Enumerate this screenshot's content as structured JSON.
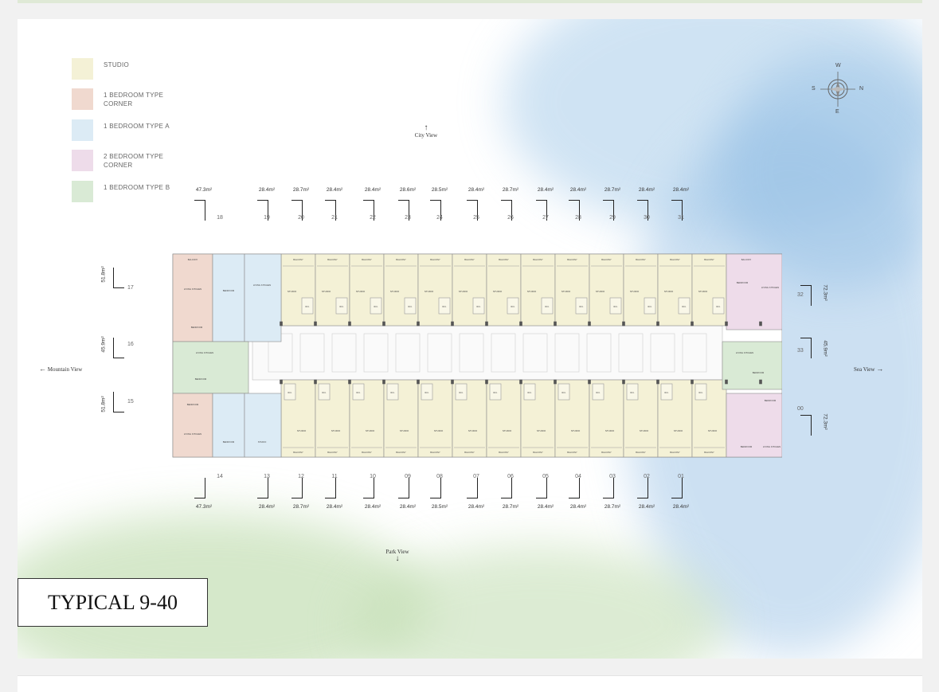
{
  "page_title": "TYPICAL 9-40",
  "legend": [
    {
      "label": "STUDIO",
      "color": "#f4f1d6"
    },
    {
      "label": "1 BEDROOM TYPE CORNER",
      "color": "#f0d9cf"
    },
    {
      "label": "1 BEDROOM TYPE A",
      "color": "#dcebf5"
    },
    {
      "label": "2 BEDROOM TYPE CORNER",
      "color": "#eedcea"
    },
    {
      "label": "1 BEDROOM TYPE B",
      "color": "#d9ead5"
    }
  ],
  "views": {
    "city": "City View",
    "park": "Park View",
    "mountain": "Mountain View",
    "sea": "Sea View"
  },
  "compass": {
    "n": "N",
    "s": "S",
    "e": "E",
    "w": "W"
  },
  "top_units": [
    {
      "area": "47.3m²",
      "no": "18"
    },
    {
      "area": "28.4m²",
      "no": "19"
    },
    {
      "area": "28.7m²",
      "no": "20"
    },
    {
      "area": "28.4m²",
      "no": "21"
    },
    {
      "area": "28.4m²",
      "no": "22"
    },
    {
      "area": "28.6m²",
      "no": "23"
    },
    {
      "area": "28.5m²",
      "no": "24"
    },
    {
      "area": "28.4m²",
      "no": "25"
    },
    {
      "area": "28.7m²",
      "no": "26"
    },
    {
      "area": "28.4m²",
      "no": "27"
    },
    {
      "area": "28.4m²",
      "no": "28"
    },
    {
      "area": "28.7m²",
      "no": "29"
    },
    {
      "area": "28.4m²",
      "no": "30"
    },
    {
      "area": "28.4m²",
      "no": "31"
    }
  ],
  "bottom_units": [
    {
      "area": "47.3m²",
      "no": "14"
    },
    {
      "area": "28.4m²",
      "no": "13"
    },
    {
      "area": "28.7m²",
      "no": "12"
    },
    {
      "area": "28.4m²",
      "no": "11"
    },
    {
      "area": "28.4m²",
      "no": "10"
    },
    {
      "area": "28.4m²",
      "no": "09"
    },
    {
      "area": "28.5m²",
      "no": "08"
    },
    {
      "area": "28.4m²",
      "no": "07"
    },
    {
      "area": "28.7m²",
      "no": "06"
    },
    {
      "area": "28.4m²",
      "no": "05"
    },
    {
      "area": "28.4m²",
      "no": "04"
    },
    {
      "area": "28.7m²",
      "no": "03"
    },
    {
      "area": "28.4m²",
      "no": "02"
    },
    {
      "area": "28.4m²",
      "no": "01"
    }
  ],
  "left_units": [
    {
      "area": "51.8m²",
      "no": "17"
    },
    {
      "area": "45.9m²",
      "no": "16"
    },
    {
      "area": "51.8m²",
      "no": "15"
    }
  ],
  "right_units": [
    {
      "area": "72.3m²",
      "no": "32"
    },
    {
      "area": "45.9m²",
      "no": "33"
    },
    {
      "area": "72.3m²",
      "no": "00"
    }
  ],
  "room_labels": {
    "balcony": "BALCONY",
    "studio": "STUDIO",
    "wc": "W.C.",
    "living": "LIVING KITCHEN",
    "bedroom": "BEDROOM"
  }
}
